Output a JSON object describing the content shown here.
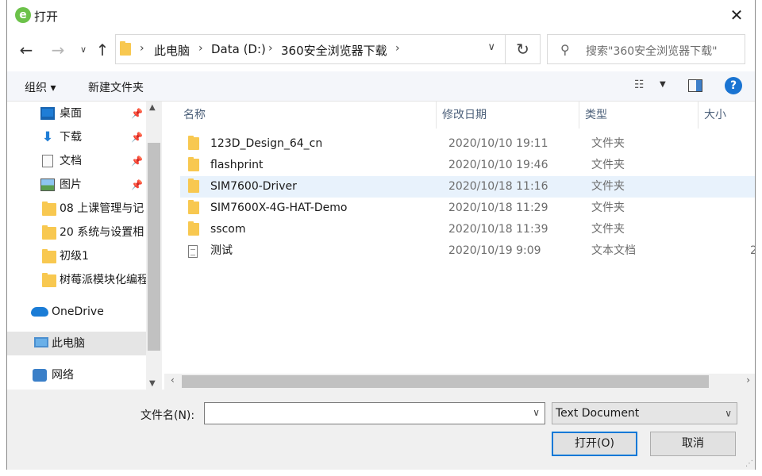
{
  "window": {
    "title": "打开",
    "app_icon_letter": "e",
    "close_glyph": "✕"
  },
  "address": {
    "segments": [
      "此电脑",
      "Data (D:)",
      "360安全浏览器下载"
    ],
    "search_placeholder": "搜索\"360安全浏览器下载\""
  },
  "toolbar": {
    "organize_label": "组织 ▾",
    "new_folder_label": "新建文件夹",
    "help_glyph": "?"
  },
  "nav_pane": {
    "items": [
      {
        "label": "桌面",
        "icon": "desktop-icon",
        "pinned": true
      },
      {
        "label": "下载",
        "icon": "download-icon",
        "pinned": true
      },
      {
        "label": "文档",
        "icon": "document-icon",
        "pinned": true
      },
      {
        "label": "图片",
        "icon": "pictures-icon",
        "pinned": true
      },
      {
        "label": "08 上课管理与记",
        "icon": "folder-icon",
        "pinned": false
      },
      {
        "label": "20 系统与设置相",
        "icon": "folder-icon",
        "pinned": false
      },
      {
        "label": "初级1",
        "icon": "folder-icon",
        "pinned": false
      },
      {
        "label": "树莓派模块化编程",
        "icon": "folder-icon",
        "pinned": false
      },
      {
        "label": "OneDrive",
        "icon": "onedrive-cloud-icon",
        "pinned": false
      },
      {
        "label": "此电脑",
        "icon": "this-pc-icon",
        "pinned": false,
        "selected": true
      },
      {
        "label": "网络",
        "icon": "network-icon",
        "pinned": false
      }
    ]
  },
  "file_list": {
    "columns": [
      "名称",
      "修改日期",
      "类型",
      "大小"
    ],
    "rows": [
      {
        "name": "123D_Design_64_cn",
        "date": "2020/10/10 19:11",
        "type": "文件夹",
        "size": "",
        "kind": "folder"
      },
      {
        "name": "flashprint",
        "date": "2020/10/10 19:46",
        "type": "文件夹",
        "size": "",
        "kind": "folder"
      },
      {
        "name": "SIM7600-Driver",
        "date": "2020/10/18 11:16",
        "type": "文件夹",
        "size": "",
        "kind": "folder",
        "selected": true
      },
      {
        "name": "SIM7600X-4G-HAT-Demo",
        "date": "2020/10/18 11:29",
        "type": "文件夹",
        "size": "",
        "kind": "folder"
      },
      {
        "name": "sscom",
        "date": "2020/10/18 11:39",
        "type": "文件夹",
        "size": "",
        "kind": "folder"
      },
      {
        "name": "测试",
        "date": "2020/10/19 9:09",
        "type": "文本文档",
        "size": "2",
        "kind": "text"
      }
    ]
  },
  "bottom": {
    "filename_label": "文件名(N):",
    "filename_value": "",
    "file_type": "Text Document",
    "open_label": "打开(O)",
    "cancel_label": "取消"
  }
}
